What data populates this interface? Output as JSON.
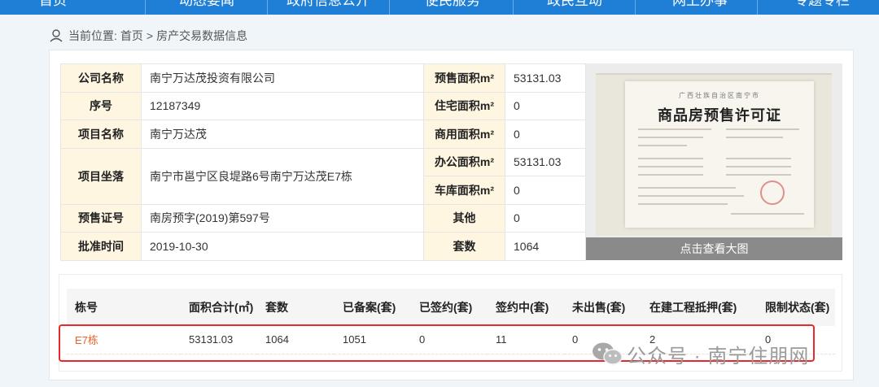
{
  "nav": {
    "items": [
      "首页",
      "动态要闻",
      "政府信息公开",
      "便民服务",
      "政民互动",
      "网上办事",
      "专题专栏"
    ]
  },
  "breadcrumb": {
    "prefix": "当前位置:",
    "home": "首页",
    "separator": ">",
    "current": "房产交易数据信息"
  },
  "info": {
    "company_label": "公司名称",
    "company": "南宁万达茂投资有限公司",
    "serial_label": "序号",
    "serial": "12187349",
    "project_label": "项目名称",
    "project": "南宁万达茂",
    "location_label": "项目坐落",
    "location": "南宁市邕宁区良堤路6号南宁万达茂E7栋",
    "permit_label": "预售证号",
    "permit": "南房预字(2019)第597号",
    "approve_label": "批准时间",
    "approve": "2019-10-30",
    "presale_area_label": "预售面积m²",
    "presale_area": "53131.03",
    "residential_area_label": "住宅面积m²",
    "residential_area": "0",
    "commercial_area_label": "商用面积m²",
    "commercial_area": "0",
    "office_area_label": "办公面积m²",
    "office_area": "53131.03",
    "garage_area_label": "车库面积m²",
    "garage_area": "0",
    "other_label": "其他",
    "other": "0",
    "units_label": "套数",
    "units": "1064"
  },
  "certificate": {
    "subtitle": "广西壮族自治区南宁市",
    "title": "商品房预售许可证",
    "view_button": "点击查看大图"
  },
  "building_table": {
    "headers": [
      "栋号",
      "面积合计(㎡)",
      "套数",
      "已备案(套)",
      "已签约(套)",
      "签约中(套)",
      "未出售(套)",
      "在建工程抵押(套)",
      "限制状态(套)"
    ],
    "rows": [
      [
        "E7栋",
        "53131.03",
        "1064",
        "1051",
        "0",
        "11",
        "0",
        "2",
        "0"
      ]
    ]
  },
  "watermark": {
    "text": "公众号 · 南宁住朋网"
  },
  "colors": {
    "nav": "#1f7fd6",
    "label_bg": "#fff6e2",
    "link": "#e8632a",
    "highlight": "#e8282c"
  }
}
